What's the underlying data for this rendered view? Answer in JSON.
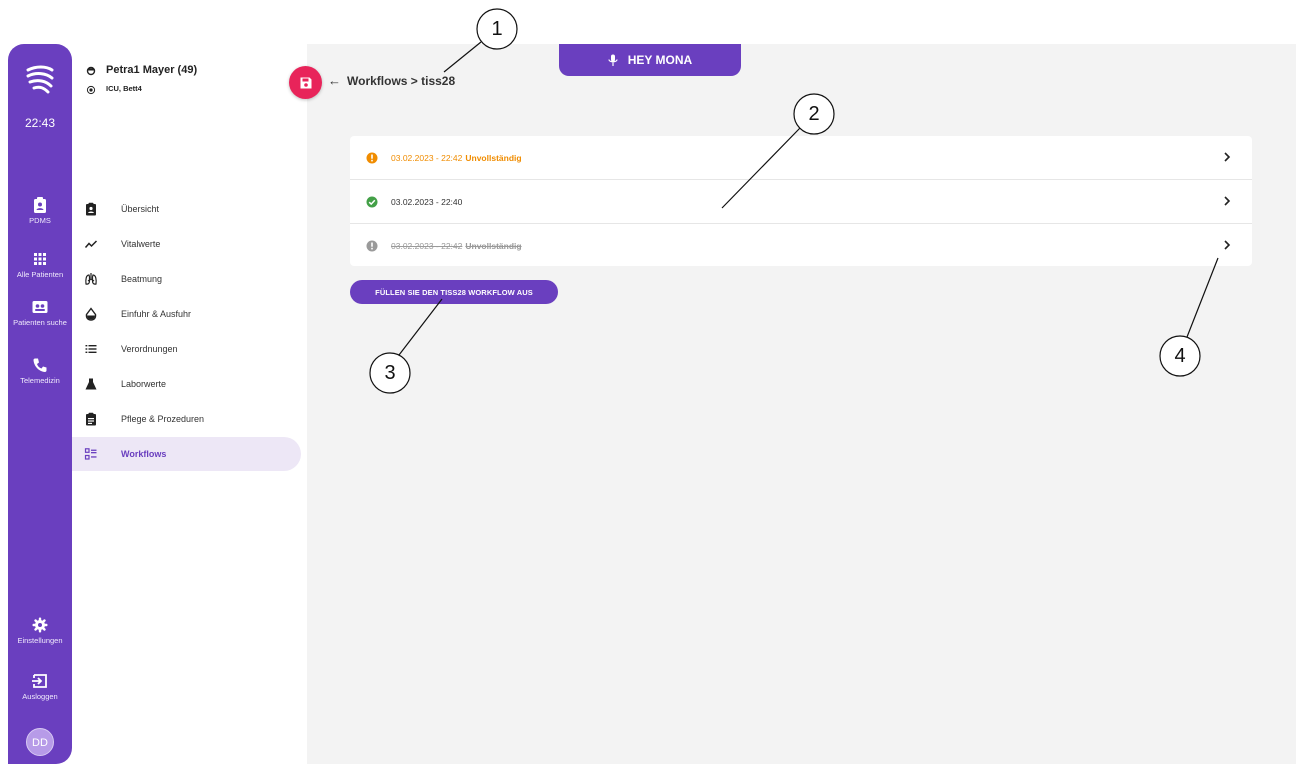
{
  "rail": {
    "time": "22:43",
    "items": [
      {
        "label": "PDMS",
        "icon": "clipboard-user-icon"
      },
      {
        "label": "Alle Patienten",
        "icon": "grid-icon"
      },
      {
        "label": "Patienten suche",
        "icon": "person-card-icon"
      },
      {
        "label": "Telemedizin",
        "icon": "phone-icon"
      },
      {
        "label": "Einstellungen",
        "icon": "gear-icon"
      },
      {
        "label": "Ausloggen",
        "icon": "logout-icon"
      }
    ],
    "avatar": "DD"
  },
  "patient": {
    "name": "Petra1 Mayer (49)",
    "location": "ICU, Bett4"
  },
  "nav": {
    "items": [
      {
        "label": "Übersicht",
        "icon": "clipboard-user-icon"
      },
      {
        "label": "Vitalwerte",
        "icon": "trend-line-icon"
      },
      {
        "label": "Beatmung",
        "icon": "lungs-icon"
      },
      {
        "label": "Einfuhr & Ausfuhr",
        "icon": "drop-icon"
      },
      {
        "label": "Verordnungen",
        "icon": "list-icon"
      },
      {
        "label": "Laborwerte",
        "icon": "flask-icon"
      },
      {
        "label": "Pflege & Prozeduren",
        "icon": "clipboard-text-icon"
      },
      {
        "label": "Workflows",
        "icon": "checklist-icon"
      }
    ],
    "active": "Workflows"
  },
  "header": {
    "hey_label": "HEY MONA",
    "back_arrow": "←",
    "breadcrumb": "Workflows > tiss28"
  },
  "workflows": [
    {
      "date": "03.02.2023 - 22:42",
      "status": "Unvollständig",
      "state": "warning"
    },
    {
      "date": "03.02.2023 - 22:40",
      "status": "",
      "state": "complete"
    },
    {
      "date": "03.02.2023 - 22:42",
      "status": "Unvollständig",
      "state": "discarded"
    }
  ],
  "fill_button": "FÜLLEN SIE DEN TISS28 WORKFLOW AUS",
  "callouts": [
    "1",
    "2",
    "3",
    "4"
  ],
  "colors": {
    "primary": "#6a3fbf",
    "save": "#e8245a",
    "warning": "#f08c00",
    "success": "#43a047",
    "disabled": "#9a9a9a"
  }
}
